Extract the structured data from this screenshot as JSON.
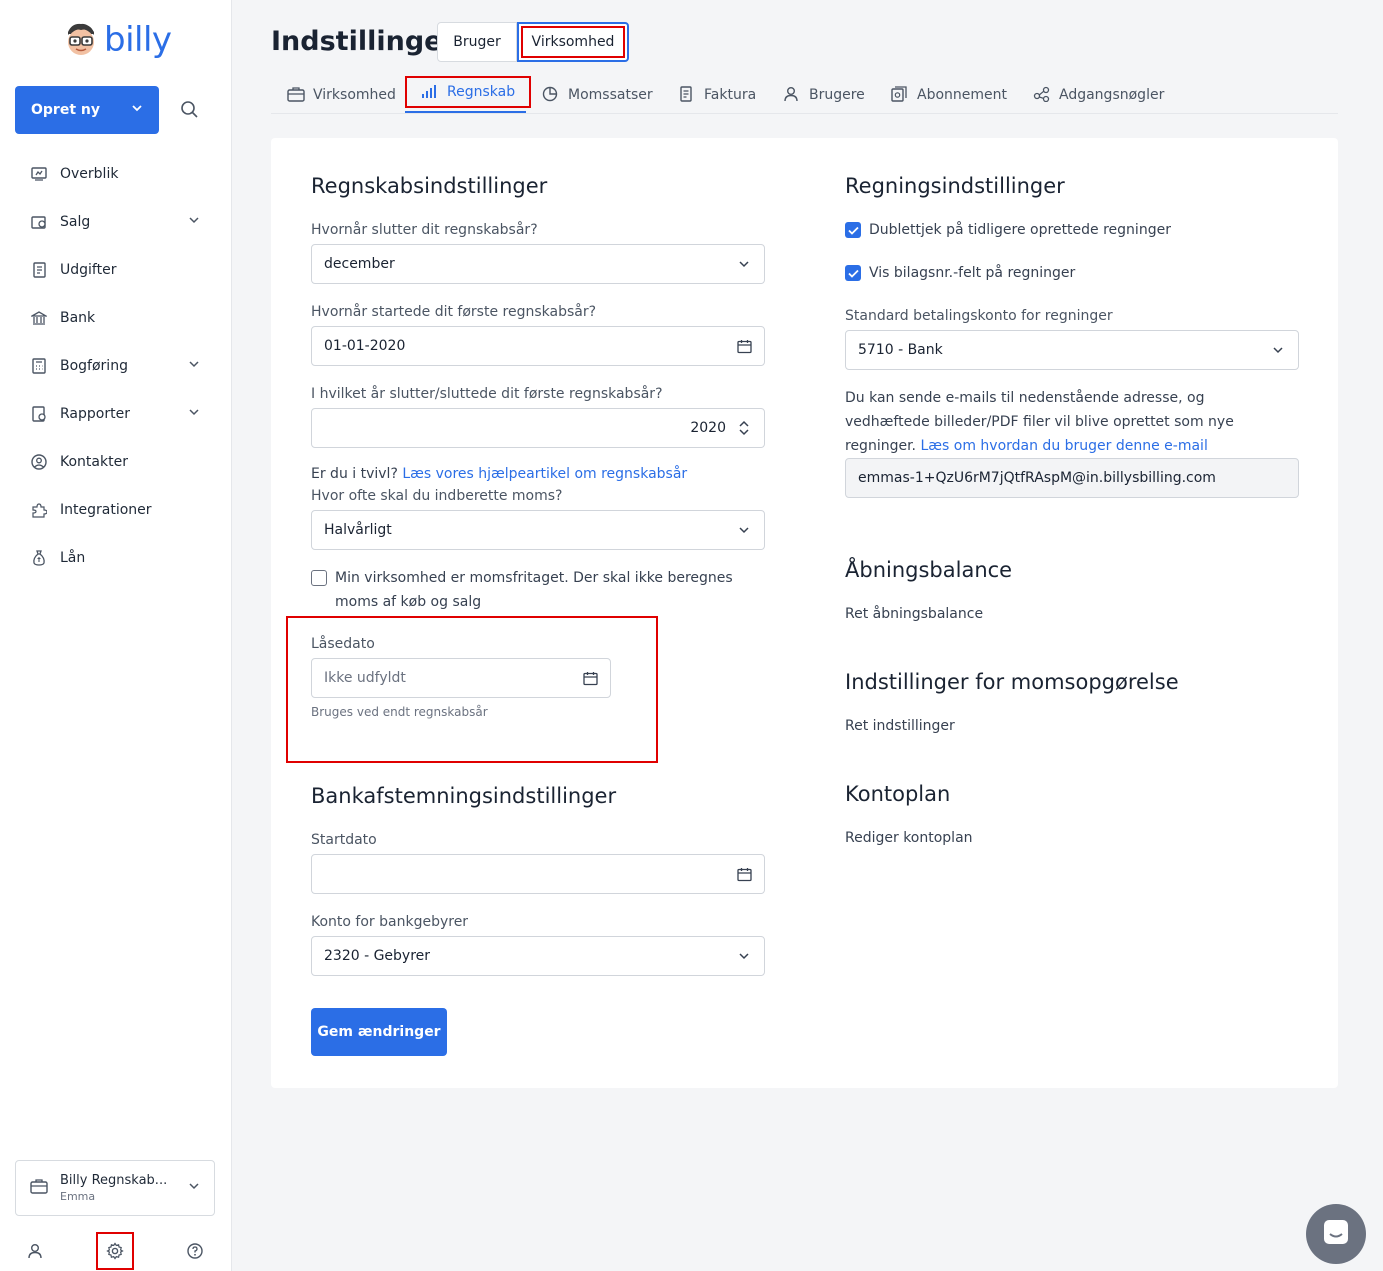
{
  "colors": {
    "accent": "#2b6ee6",
    "highlight": "#e00000"
  },
  "sidebar": {
    "logo_text": "billy",
    "create_label": "Opret ny",
    "items": [
      {
        "label": "Overblik",
        "icon": "dashboard-icon",
        "expandable": false
      },
      {
        "label": "Salg",
        "icon": "sales-icon",
        "expandable": true
      },
      {
        "label": "Udgifter",
        "icon": "expenses-icon",
        "expandable": false
      },
      {
        "label": "Bank",
        "icon": "bank-icon",
        "expandable": false
      },
      {
        "label": "Bogføring",
        "icon": "calculator-icon",
        "expandable": true
      },
      {
        "label": "Rapporter",
        "icon": "reports-icon",
        "expandable": true
      },
      {
        "label": "Kontakter",
        "icon": "contacts-icon",
        "expandable": false
      },
      {
        "label": "Integrationer",
        "icon": "puzzle-icon",
        "expandable": false
      },
      {
        "label": "Lån",
        "icon": "money-bag-icon",
        "expandable": false
      }
    ],
    "company_name": "Billy Regnskab...",
    "user_name": "Emma"
  },
  "header": {
    "title": "Indstillinger",
    "segments": [
      "Bruger",
      "Virksomhed"
    ]
  },
  "tabs": [
    {
      "label": "Virksomhed",
      "icon": "briefcase-icon"
    },
    {
      "label": "Regnskab",
      "icon": "bar-chart-icon"
    },
    {
      "label": "Momssatser",
      "icon": "pie-chart-icon"
    },
    {
      "label": "Faktura",
      "icon": "invoice-icon"
    },
    {
      "label": "Brugere",
      "icon": "user-icon"
    },
    {
      "label": "Abonnement",
      "icon": "subscription-icon"
    },
    {
      "label": "Adgangsnøgler",
      "icon": "share-nodes-icon"
    }
  ],
  "accounting": {
    "title": "Regnskabsindstillinger",
    "fy_end_label": "Hvornår slutter dit regnskabsår?",
    "fy_end_value": "december",
    "first_fy_start_label": "Hvornår startede dit første regnskabsår?",
    "first_fy_start_value": "01-01-2020",
    "first_fy_end_year_label": "I hvilket år slutter/sluttede dit første regnskabsår?",
    "first_fy_end_year_value": "2020",
    "help_prefix": "Er du i tvivl?",
    "help_link": "Læs vores hjælpeartikel om regnskabsår",
    "vat_period_label": "Hvor ofte skal du indberette moms?",
    "vat_period_value": "Halvårligt",
    "vat_exempt_label": "Min virksomhed er momsfritaget. Der skal ikke beregnes moms af køb og salg",
    "lock_date_label": "Låsedato",
    "lock_date_placeholder": "Ikke udfyldt",
    "lock_date_hint": "Bruges ved endt regnskabsår"
  },
  "bank": {
    "title": "Bankafstemningsindstillinger",
    "start_date_label": "Startdato",
    "start_date_value": "",
    "fee_account_label": "Konto for bankgebyrer",
    "fee_account_value": "2320 - Gebyrer"
  },
  "save_label": "Gem ændringer",
  "bills": {
    "title": "Regningsindstillinger",
    "duplicate_check_label": "Dublettjek på tidligere oprettede regninger",
    "show_voucher_label": "Vis bilagsnr.-felt på regninger",
    "default_account_label": "Standard betalingskonto for regninger",
    "default_account_value": "5710 - Bank",
    "email_text": "Du kan sende e-mails til nedenstående adresse, og vedhæftede billeder/PDF filer vil blive oprettet som nye regninger.",
    "email_link": "Læs om hvordan du bruger denne e-mail",
    "email_address": "emmas-1+QzU6rM7jQtfRAspM@in.billysbilling.com"
  },
  "opening_balance": {
    "title": "Åbningsbalance",
    "link": "Ret åbningsbalance"
  },
  "vat_report": {
    "title": "Indstillinger for momsopgørelse",
    "link": "Ret indstillinger"
  },
  "chart_of_accounts": {
    "title": "Kontoplan",
    "link": "Rediger kontoplan"
  }
}
